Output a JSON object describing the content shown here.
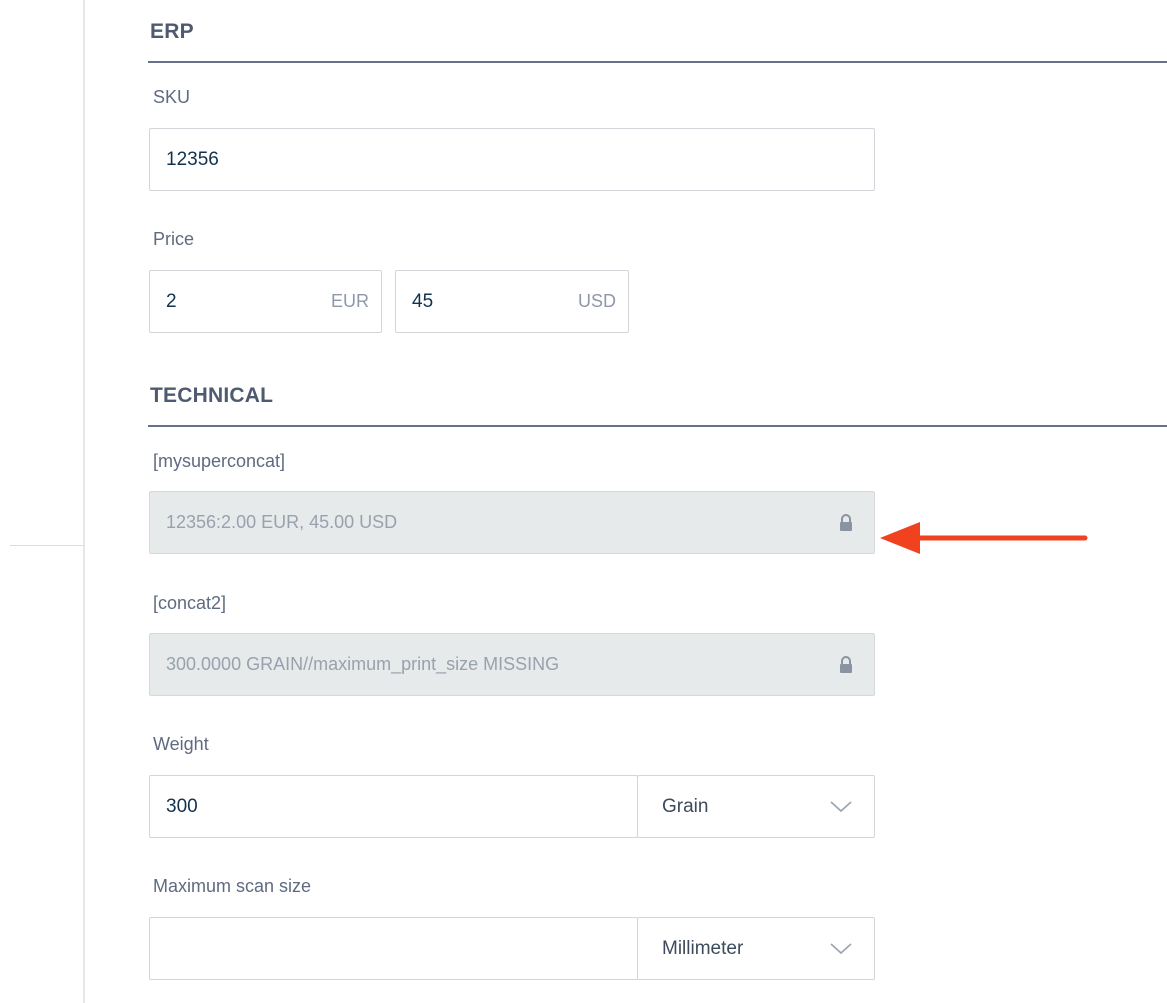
{
  "sections": {
    "erp": {
      "title": "ERP"
    },
    "technical": {
      "title": "TECHNICAL"
    }
  },
  "fields": {
    "sku": {
      "label": "SKU",
      "value": "12356"
    },
    "price": {
      "label": "Price",
      "eur": {
        "value": "2",
        "currency": "EUR"
      },
      "usd": {
        "value": "45",
        "currency": "USD"
      }
    },
    "mysuperconcat": {
      "label": "[mysuperconcat]",
      "value": "12356:2.00 EUR, 45.00 USD",
      "locked": true
    },
    "concat2": {
      "label": "[concat2]",
      "value": "300.0000 GRAIN//maximum_print_size MISSING",
      "locked": true
    },
    "weight": {
      "label": "Weight",
      "value": "300",
      "unit": "Grain"
    },
    "max_scan_size": {
      "label": "Maximum scan size",
      "value": "",
      "unit": "Millimeter"
    }
  },
  "icons": {
    "lock": "lock-icon",
    "chevron": "chevron-down-icon",
    "arrow": "arrow-left-icon"
  },
  "colors": {
    "annotation_arrow": "#f0421f",
    "section_rule": "#67718a",
    "readonly_bg": "#e7eaea"
  }
}
